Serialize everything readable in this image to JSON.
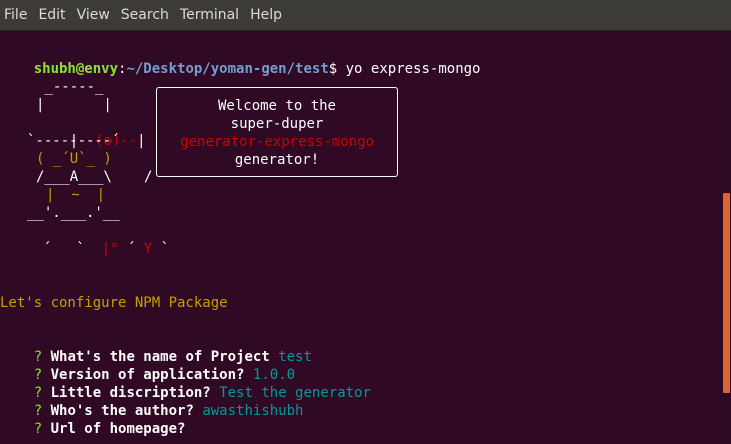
{
  "menubar": {
    "items": [
      "File",
      "Edit",
      "View",
      "Search",
      "Terminal",
      "Help"
    ]
  },
  "prompt": {
    "user_host": "shubh@envy",
    "separator": ":",
    "path": "~/Desktop/yoman-gen/test",
    "symbol": "$",
    "command": " yo express-mongo"
  },
  "yeoman_art": {
    "row1": " _-----_",
    "row2_a": "|       |",
    "row3_a": "|--(o)--|",
    "row4": "`---------´",
    "row5": "( _´U`_ )",
    "row6": "/___A___\\",
    "row6_tail": "/",
    "row7": "|  ~  |",
    "row8": "__'.___.'__",
    "row9_a": "´   `  |° ´ Y `",
    "row9_red": "|°",
    "row9_y": "Y"
  },
  "speech": {
    "line1": "Welcome to the",
    "line2": "super-duper",
    "line3": "generator-express-mongo",
    "line4": "generator!"
  },
  "configure_text": "Let's configure NPM Package",
  "questions": [
    {
      "mark": "?",
      "text": "What's the name of Project",
      "answer": "test"
    },
    {
      "mark": "?",
      "text": "Version of application?",
      "answer": "1.0.0"
    },
    {
      "mark": "?",
      "text": "Little discription?",
      "answer": "Test the generator"
    },
    {
      "mark": "?",
      "text": "Who's the author?",
      "answer": "awasthishubh"
    },
    {
      "mark": "?",
      "text": "Url of homepage?",
      "answer": ""
    }
  ],
  "colors": {
    "background": "#300a24",
    "prompt_user": "#8ae234",
    "prompt_path": "#729fcf",
    "answer": "#06989a",
    "yellow": "#c4a000",
    "red": "#cc0000"
  }
}
